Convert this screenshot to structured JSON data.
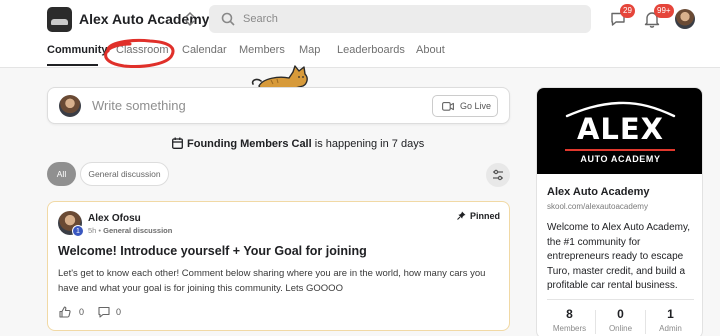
{
  "header": {
    "brand": "Alex Auto Academy",
    "search_placeholder": "Search",
    "chat_badge": "29",
    "notification_badge": "99+"
  },
  "tabs": [
    {
      "label": "Community",
      "active": true
    },
    {
      "label": "Classroom",
      "active": false
    },
    {
      "label": "Calendar",
      "active": false
    },
    {
      "label": "Members",
      "active": false
    },
    {
      "label": "Map",
      "active": false
    },
    {
      "label": "Leaderboards",
      "active": false
    },
    {
      "label": "About",
      "active": false
    }
  ],
  "compose": {
    "placeholder": "Write something",
    "go_live": "Go Live"
  },
  "event": {
    "title": "Founding Members Call",
    "suffix": " is happening in 7 days"
  },
  "filters": {
    "all": "All",
    "general": "General discussion"
  },
  "post": {
    "author": "Alex Ofosu",
    "level": "1",
    "time": "5h",
    "separator": " • ",
    "category": "General discussion",
    "pinned": "Pinned",
    "title": "Welcome! Introduce yourself + Your Goal for joining",
    "body": "Let's get to know each other! Comment below sharing where you are in the world, how many cars you have and what your goal is for joining this community. Lets GOOOO",
    "likes": "0",
    "comments": "0"
  },
  "sidebar": {
    "banner_title": "ALEX",
    "banner_subtitle": "AUTO ACADEMY",
    "name": "Alex Auto Academy",
    "url": "skool.com/alexautoacademy",
    "description": "Welcome to Alex Auto Academy, the #1 community for entrepreneurs ready to escape Turo, master credit, and build a profitable car rental business.",
    "stats": [
      {
        "value": "8",
        "label": "Members"
      },
      {
        "value": "0",
        "label": "Online"
      },
      {
        "value": "1",
        "label": "Admin"
      }
    ]
  },
  "colors": {
    "badge": "#e5453a",
    "annotation": "#e0302a",
    "cat": "#d79a3a",
    "pinned_border": "#f1d9a5",
    "level_badge": "#3a57c0"
  }
}
